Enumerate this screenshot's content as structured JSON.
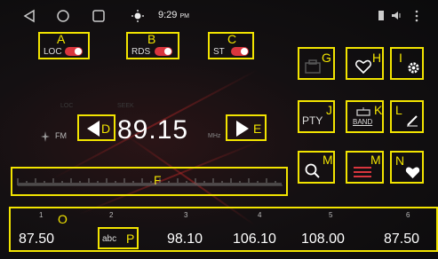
{
  "status_bar": {
    "time": "9:29",
    "ampm": "PM"
  },
  "toggles": [
    {
      "label": "LOC",
      "callout": "A"
    },
    {
      "label": "RDS",
      "callout": "B"
    },
    {
      "label": "ST",
      "callout": "C"
    }
  ],
  "faded": {
    "loc": "LOC",
    "seek": "SEEK"
  },
  "tuner": {
    "band": "FM",
    "frequency": "89.15",
    "unit": "MHz",
    "prev_callout": "D",
    "next_callout": "E"
  },
  "scale": {
    "callout": "F"
  },
  "buttons": {
    "save": {
      "callout": "G"
    },
    "favorite": {
      "callout": "H"
    },
    "settings": {
      "callout": "I"
    },
    "pty": {
      "label": "PTY",
      "callout": "J"
    },
    "band": {
      "label": "BAND",
      "callout": "K"
    },
    "edit": {
      "callout": "L"
    },
    "search": {
      "callout": "M"
    },
    "list": {
      "callout": "M"
    },
    "favorites_list": {
      "callout": "N"
    }
  },
  "presets": {
    "callout": "O",
    "items": [
      {
        "number": "1",
        "value": "87.50"
      },
      {
        "number": "2",
        "value": "abc",
        "callout": "P"
      },
      {
        "number": "3",
        "value": "98.10"
      },
      {
        "number": "4",
        "value": "106.10"
      },
      {
        "number": "5",
        "value": "108.00"
      },
      {
        "number": "6",
        "value": "87.50"
      }
    ]
  },
  "colors": {
    "callout": "#f2e400",
    "accent": "#d9363e"
  }
}
